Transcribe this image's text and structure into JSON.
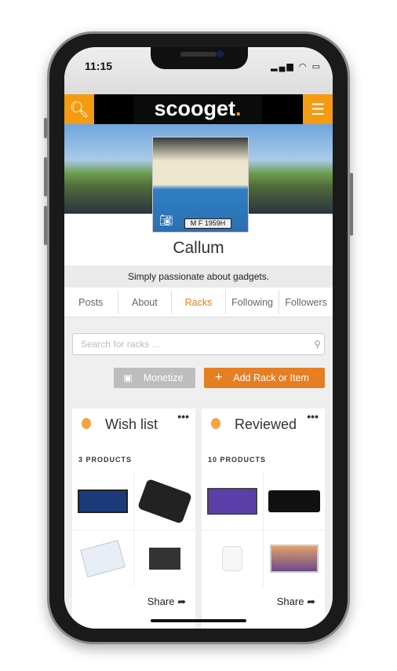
{
  "status": {
    "time": "11:15",
    "icons": [
      "signal-icon",
      "wifi-icon",
      "battery-icon"
    ]
  },
  "header": {
    "logo": "scooget",
    "logo_dot": ".",
    "search_icon": "search-icon",
    "menu_icon": "menu-icon",
    "accent": "#f39c12"
  },
  "profile": {
    "name": "Callum",
    "bio": "Simply passionate about gadgets.",
    "plate": "M F 1959H"
  },
  "tabs": [
    {
      "label": "Posts"
    },
    {
      "label": "About"
    },
    {
      "label": "Racks",
      "active": true
    },
    {
      "label": "Following"
    },
    {
      "label": "Followers"
    }
  ],
  "search": {
    "placeholder": "Search for racks ..."
  },
  "actions": {
    "monetize": "Monetize",
    "add": "Add Rack or Item",
    "add_color": "#e67e22"
  },
  "racks": [
    {
      "title": "Wish list",
      "count": "3 PRODUCTS",
      "share": "Share",
      "items": [
        "laptop",
        "dac",
        "box",
        "headphone-amp"
      ]
    },
    {
      "title": "Reviewed",
      "count": "10 PRODUCTS",
      "share": "Share",
      "items": [
        "laptop",
        "amplifier",
        "airpods",
        "macbook"
      ]
    }
  ]
}
